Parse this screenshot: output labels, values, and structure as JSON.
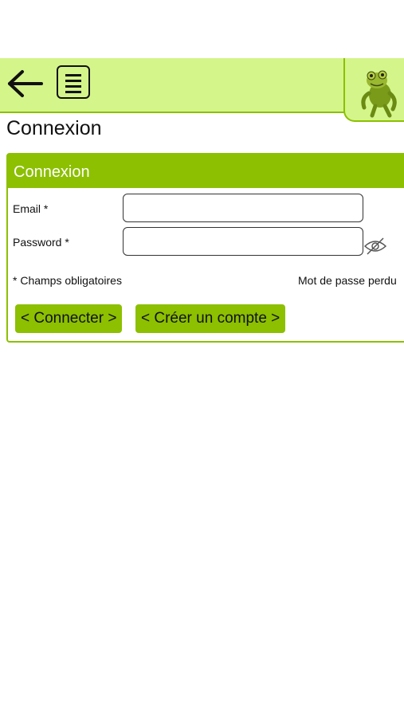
{
  "page": {
    "title": "Connexion"
  },
  "topbar": {
    "back_icon": "arrow-left-icon",
    "menu_icon": "document-menu-icon",
    "logo": "frog-mascot-logo"
  },
  "form": {
    "header": "Connexion",
    "email_label": "Email *",
    "email_value": "",
    "email_placeholder": "",
    "password_label": "Password *",
    "password_value": "",
    "password_placeholder": "",
    "toggle_icon": "eye-slash-icon",
    "required_note": "* Champs obligatoires",
    "forgot_link": "Mot de passe perdu",
    "connect_button": "< Connecter >",
    "create_button": "< Créer un compte >"
  },
  "colors": {
    "accent": "#8cc000",
    "light_accent": "#d4f58a",
    "header_text": "#ffffff"
  }
}
